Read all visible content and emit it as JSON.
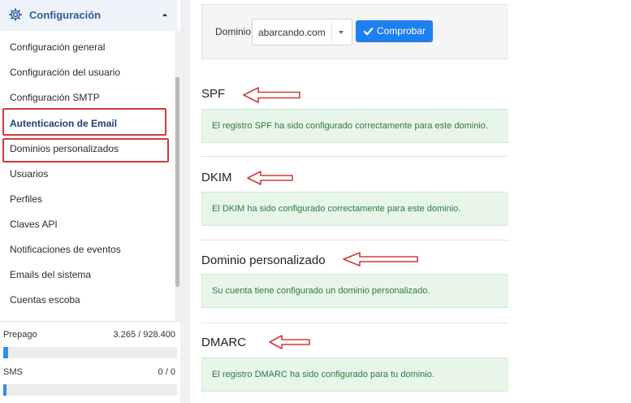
{
  "sidebar": {
    "section_title": "Configuración",
    "items": [
      {
        "label": "Configuración general"
      },
      {
        "label": "Configuración del usuario"
      },
      {
        "label": "Configuración SMTP"
      },
      {
        "label": "Autenticacion de Email"
      },
      {
        "label": "Dominios personalizados"
      },
      {
        "label": "Usuarios"
      },
      {
        "label": "Perfiles"
      },
      {
        "label": "Claves API"
      },
      {
        "label": "Notificaciones de eventos"
      },
      {
        "label": "Emails del sistema"
      },
      {
        "label": "Cuentas escoba"
      }
    ],
    "quotas": [
      {
        "label": "Prepago",
        "value": "3.265 / 928.400",
        "fraction": 0.0035
      },
      {
        "label": "SMS",
        "value": "0 / 0",
        "fraction": 0
      }
    ]
  },
  "domain_check": {
    "label": "Dominio",
    "selected": "abarcando.com",
    "button_label": "Comprobar"
  },
  "sections": [
    {
      "title": "SPF",
      "message": "El registro SPF ha sido configurado correctamente para este dominio."
    },
    {
      "title": "DKIM",
      "message": "El DKIM ha sido configurado correctamente para este dominio."
    },
    {
      "title": "Dominio personalizado",
      "message": "Su cuenta tiene configurado un dominio personalizado."
    },
    {
      "title": "DMARC",
      "message": "El registro DMARC ha sido configurado para tu dominio."
    }
  ],
  "colors": {
    "accent": "#1e7ff0",
    "success_bg": "#e8f6ea",
    "success_text": "#2d7a3a",
    "annotation_red": "#d23a3a"
  }
}
